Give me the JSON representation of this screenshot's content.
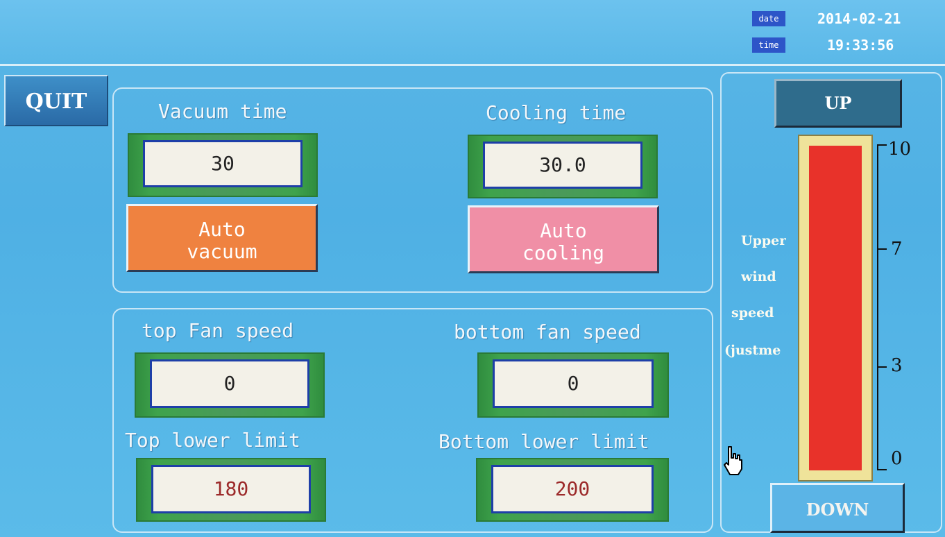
{
  "header": {
    "date_tag": "date",
    "date_value": "2014-02-21",
    "time_tag": "time",
    "time_value": "19:33:56"
  },
  "quit_label": "QUIT",
  "timing": {
    "vacuum_label": "Vacuum time",
    "vacuum_value": "30",
    "cooling_label": "Cooling time",
    "cooling_value": "30.0",
    "auto_vacuum_line1": "Auto",
    "auto_vacuum_line2": "vacuum",
    "auto_cooling_line1": "Auto",
    "auto_cooling_line2": "cooling"
  },
  "fans": {
    "top_speed_label": "top Fan speed",
    "top_speed_value": "0",
    "bottom_speed_label": "bottom fan speed",
    "bottom_speed_value": "0",
    "top_lower_label": "Top lower limit",
    "top_lower_value": "180",
    "bottom_lower_label": "Bottom lower limit",
    "bottom_lower_value": "200"
  },
  "wind": {
    "up_label": "UP",
    "down_label": "DOWN",
    "side_line1": "Upper",
    "side_line2": "wind",
    "side_line3": "speed",
    "side_line4": "(justme",
    "ticks": [
      "10",
      "7",
      "3",
      "0"
    ],
    "level": 10,
    "bar_color": "#e8322a",
    "bar_border": "#efe39a"
  },
  "colors": {
    "auto_vacuum": "#ef8240",
    "auto_cooling": "#f08fa6",
    "up_button": "#2f6c8c",
    "down_button": "#5bb4e6"
  }
}
